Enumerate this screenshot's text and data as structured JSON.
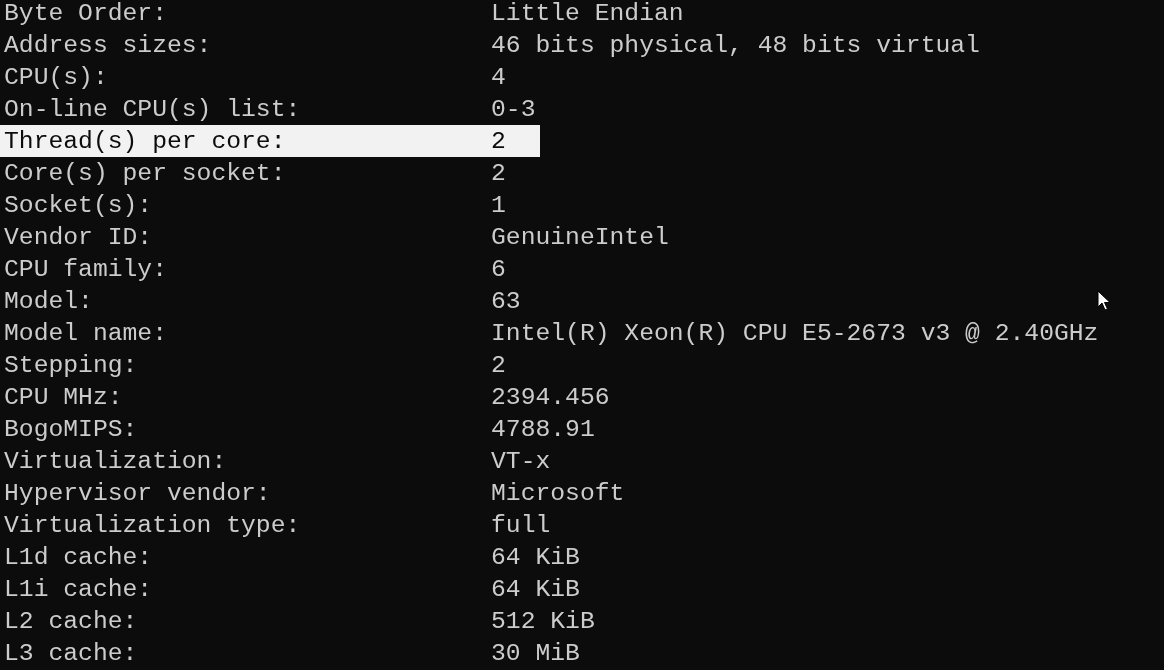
{
  "lines": [
    {
      "label": "Byte Order:",
      "value": "Little Endian",
      "selected": false
    },
    {
      "label": "Address sizes:",
      "value": "46 bits physical, 48 bits virtual",
      "selected": false
    },
    {
      "label": "CPU(s):",
      "value": "4",
      "selected": false
    },
    {
      "label": "On-line CPU(s) list:",
      "value": "0-3",
      "selected": false
    },
    {
      "label": "Thread(s) per core:",
      "value": "2",
      "selected": true
    },
    {
      "label": "Core(s) per socket:",
      "value": "2",
      "selected": false
    },
    {
      "label": "Socket(s):",
      "value": "1",
      "selected": false
    },
    {
      "label": "Vendor ID:",
      "value": "GenuineIntel",
      "selected": false
    },
    {
      "label": "CPU family:",
      "value": "6",
      "selected": false
    },
    {
      "label": "Model:",
      "value": "63",
      "selected": false
    },
    {
      "label": "Model name:",
      "value": "Intel(R) Xeon(R) CPU E5-2673 v3 @ 2.40GHz",
      "selected": false
    },
    {
      "label": "Stepping:",
      "value": "2",
      "selected": false
    },
    {
      "label": "CPU MHz:",
      "value": "2394.456",
      "selected": false
    },
    {
      "label": "BogoMIPS:",
      "value": "4788.91",
      "selected": false
    },
    {
      "label": "Virtualization:",
      "value": "VT-x",
      "selected": false
    },
    {
      "label": "Hypervisor vendor:",
      "value": "Microsoft",
      "selected": false
    },
    {
      "label": "Virtualization type:",
      "value": "full",
      "selected": false
    },
    {
      "label": "L1d cache:",
      "value": "64 KiB",
      "selected": false
    },
    {
      "label": "L1i cache:",
      "value": "64 KiB",
      "selected": false
    },
    {
      "label": "L2 cache:",
      "value": "512 KiB",
      "selected": false
    },
    {
      "label": "L3 cache:",
      "value": "30 MiB",
      "selected": false
    }
  ]
}
